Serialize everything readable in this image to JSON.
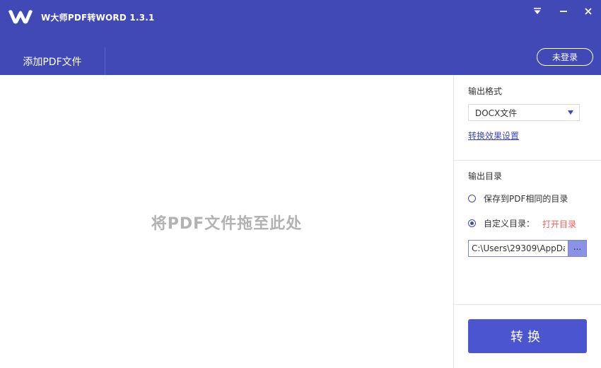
{
  "app": {
    "title": "W大师PDF转WORD 1.3.1",
    "accent_color": "#4049b5",
    "window_controls": [
      "dropdown-menu-icon",
      "minimize-icon",
      "close-icon"
    ]
  },
  "header": {
    "add_tab_label": "添加PDF文件",
    "login_label": "未登录"
  },
  "drop_zone": {
    "hint": "将PDF文件拖至此处"
  },
  "output_format": {
    "label": "输出格式",
    "selected": "DOCX文件",
    "settings_link": "转换效果设置"
  },
  "output_dir": {
    "label": "输出目录",
    "option_same": "保存到PDF相同的目录",
    "option_custom": "自定义目录：",
    "selected_option": "custom",
    "open_dir_link": "打开目录",
    "path_value": "C:\\Users\\29309\\AppDa",
    "browse_label": "..."
  },
  "convert": {
    "label": "转换"
  }
}
